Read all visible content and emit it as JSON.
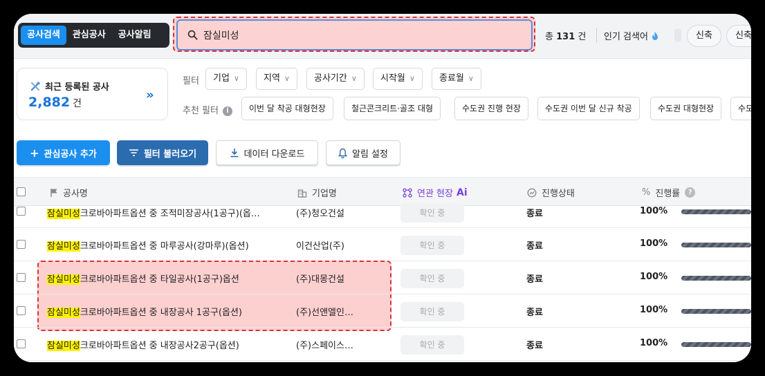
{
  "topbar": {
    "tabs": [
      {
        "label": "공사검색",
        "active": true
      },
      {
        "label": "관심공사",
        "active": false
      },
      {
        "label": "공사알림",
        "active": false
      }
    ],
    "search_value": "잠실미성",
    "total_prefix": "총",
    "total_count": "131",
    "total_suffix": "건",
    "popular_label": "인기 검색어",
    "popular_keywords": [
      "신축",
      "신축"
    ]
  },
  "recent": {
    "title": "최근 등록된 공사",
    "count": "2,882",
    "unit": "건",
    "arrow": "»"
  },
  "filters": {
    "label": "필터",
    "items": [
      "기업",
      "지역",
      "공사기간",
      "시작월",
      "종료월"
    ],
    "recommend_label": "추천 필터",
    "recommend_items": [
      "이번 달 착공 대형현장",
      "철근콘크리트·골조 대형",
      "수도권 진행 현장",
      "수도권 이번 달 신규 착공",
      "수도권 대형현장",
      "수도"
    ]
  },
  "actions": {
    "add_interest": "관심공사 추가",
    "load_filter": "필터 불러오기",
    "download": "데이터 다운로드",
    "alert_settings": "알림 설정"
  },
  "table": {
    "headers": {
      "name": "공사명",
      "company": "기업명",
      "related": "연관 현장",
      "ai": "Ai",
      "status": "진행상태",
      "progress": "진행률"
    },
    "rows": [
      {
        "highlight": "잠실미성",
        "rest": "크로바아파트옵션 중 조적미장공사(1공구)(옵…",
        "company": "(주)청오건설",
        "pill": "확인 중",
        "status": "종료",
        "progress": "100%"
      },
      {
        "highlight": "잠실미성",
        "rest": "크로바아파트옵션 중 마루공사(강마루)(옵션)",
        "company": "이건산업(주)",
        "pill": "확인 중",
        "status": "종료",
        "progress": "100%"
      },
      {
        "highlight": "잠실미성",
        "rest": "크로바아파트옵션 중 타일공사(1공구)옵션",
        "company": "(주)대몽건설",
        "pill": "확인 중",
        "status": "종료",
        "progress": "100%"
      },
      {
        "highlight": "잠실미성",
        "rest": "크로바아파트옵션 중 내장공사 1공구(옵션)",
        "company": "(주)선앤엘인…",
        "pill": "확인 중",
        "status": "종료",
        "progress": "100%"
      },
      {
        "highlight": "잠실미성",
        "rest": "크로바아파트옵션 중 내장공사2공구(옵션)",
        "company": "(주)스페이스…",
        "pill": "확인 중",
        "status": "종료",
        "progress": "100%"
      }
    ]
  }
}
